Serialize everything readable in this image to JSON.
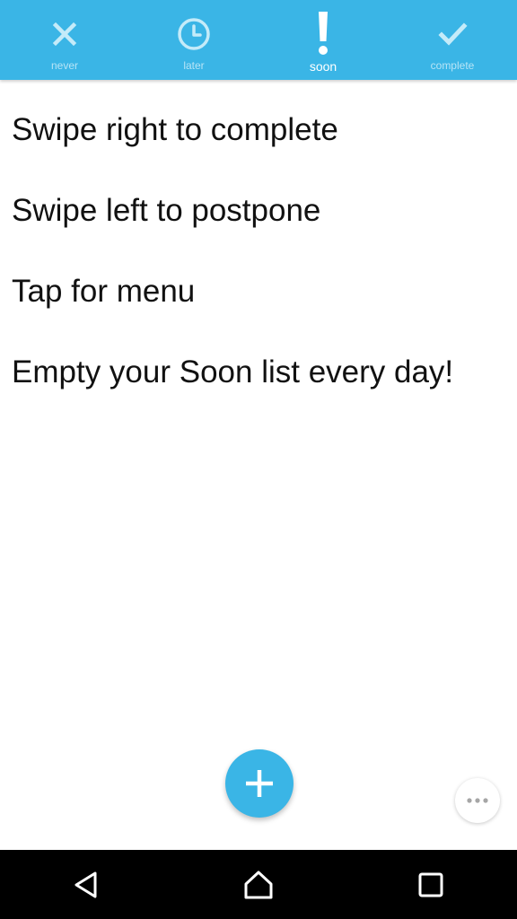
{
  "tabs": [
    {
      "key": "never",
      "label": "never",
      "icon": "close-icon",
      "active": false
    },
    {
      "key": "later",
      "label": "later",
      "icon": "clock-icon",
      "active": false
    },
    {
      "key": "soon",
      "label": "soon",
      "icon": "exclamation-icon",
      "active": true
    },
    {
      "key": "complete",
      "label": "complete",
      "icon": "check-icon",
      "active": false
    }
  ],
  "items": [
    "Swipe right to complete",
    "Swipe left to postpone",
    "Tap for menu",
    "Empty your Soon list every day!"
  ],
  "fab": {
    "icon": "plus-icon"
  },
  "more": {
    "icon": "more-horizontal-icon"
  },
  "navbar": {
    "back": "back-triangle-icon",
    "home": "home-icon",
    "recents": "recents-square-icon"
  },
  "colors": {
    "accent": "#3ab5e6",
    "tab_inactive": "#c4ebf9",
    "text": "#111111",
    "navbar": "#000000"
  }
}
